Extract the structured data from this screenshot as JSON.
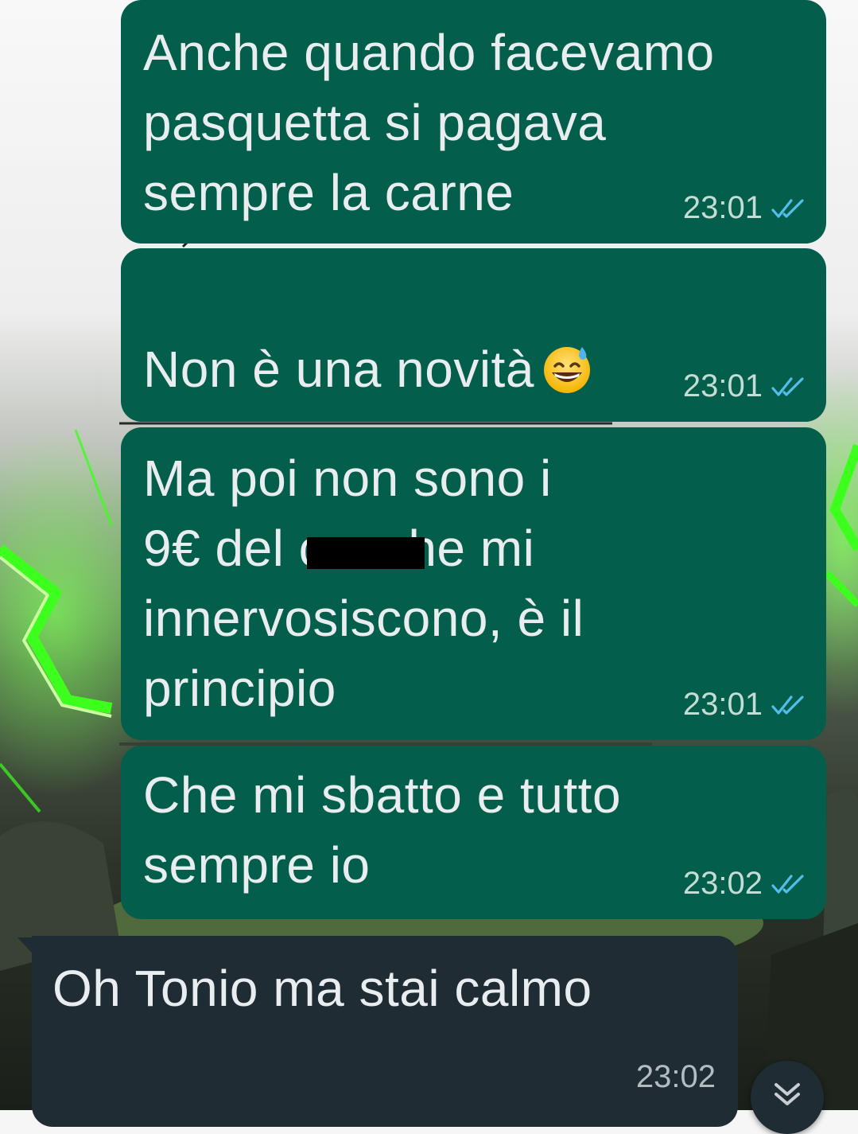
{
  "chat": {
    "messages": [
      {
        "direction": "outgoing",
        "text": "Anche quando facevamo\npasquetta si pagava\nsempre la carne",
        "time": "23:01",
        "status": "read-double-check-icon"
      },
      {
        "direction": "outgoing",
        "text": "Non è una novità",
        "emoji": "grinning-face-with-sweat",
        "time": "23:01",
        "status": "read-double-check-icon"
      },
      {
        "direction": "outgoing",
        "text": "Ma poi non sono i\n9€ del c            o che mi\ninnervosiscono, è il\nprincipio",
        "time": "23:01",
        "status": "read-double-check-icon"
      },
      {
        "direction": "outgoing",
        "text": "Che mi sbatto e tutto\nsempre io",
        "time": "23:02",
        "status": "read-double-check-icon"
      },
      {
        "direction": "incoming",
        "text": "Oh Tonio ma stai calmo",
        "time": "23:02"
      }
    ]
  },
  "icons": {
    "scroll_down": "double-chevron-down-icon",
    "read_receipt": "double-check-icon"
  },
  "colors": {
    "outgoing_bubble": "#035e4b",
    "incoming_bubble": "#1f2c34",
    "read_tick": "#53bdeb",
    "wallpaper_accent": "#3cff1e"
  }
}
